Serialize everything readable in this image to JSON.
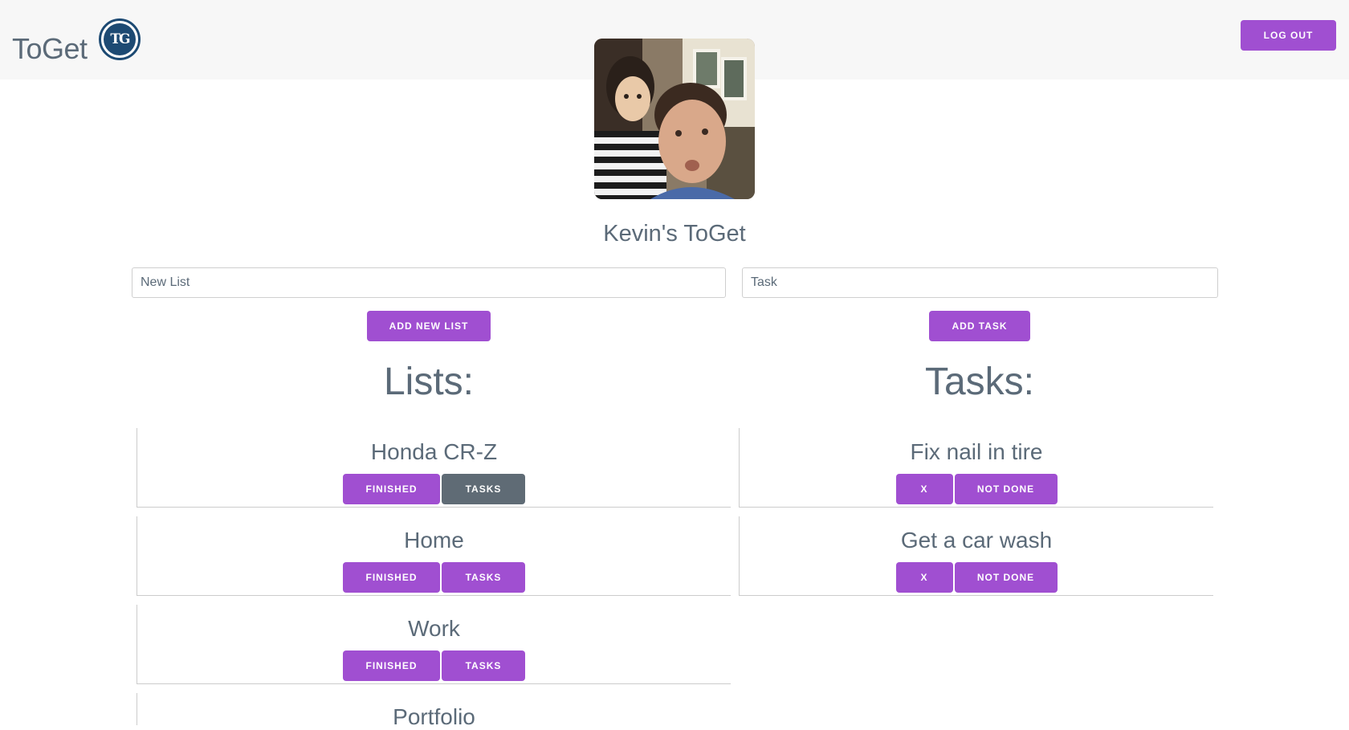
{
  "header": {
    "brand": "ToGet",
    "logo_text": "TG",
    "logout_label": "LOG OUT"
  },
  "profile": {
    "title": "Kevin's ToGet"
  },
  "forms": {
    "list_placeholder": "New List",
    "task_placeholder": "Task",
    "add_list_label": "ADD NEW LIST",
    "add_task_label": "ADD TASK"
  },
  "lists": {
    "heading": "Lists:",
    "items": [
      {
        "name": "Honda CR-Z",
        "finished_label": "FINISHED",
        "tasks_label": "TASKS",
        "selected": true
      },
      {
        "name": "Home",
        "finished_label": "FINISHED",
        "tasks_label": "TASKS",
        "selected": false
      },
      {
        "name": "Work",
        "finished_label": "FINISHED",
        "tasks_label": "TASKS",
        "selected": false
      },
      {
        "name": "Portfolio"
      }
    ]
  },
  "tasks": {
    "heading": "Tasks:",
    "items": [
      {
        "name": "Fix nail in tire",
        "delete_label": "X",
        "status_label": "NOT DONE"
      },
      {
        "name": "Get a car wash",
        "delete_label": "X",
        "status_label": "NOT DONE"
      }
    ]
  },
  "colors": {
    "accent": "#a04fd1",
    "active_button": "#5f6b75",
    "text": "#5b6a78",
    "header_bg": "#f7f7f7",
    "logo": "#1d4a73"
  }
}
